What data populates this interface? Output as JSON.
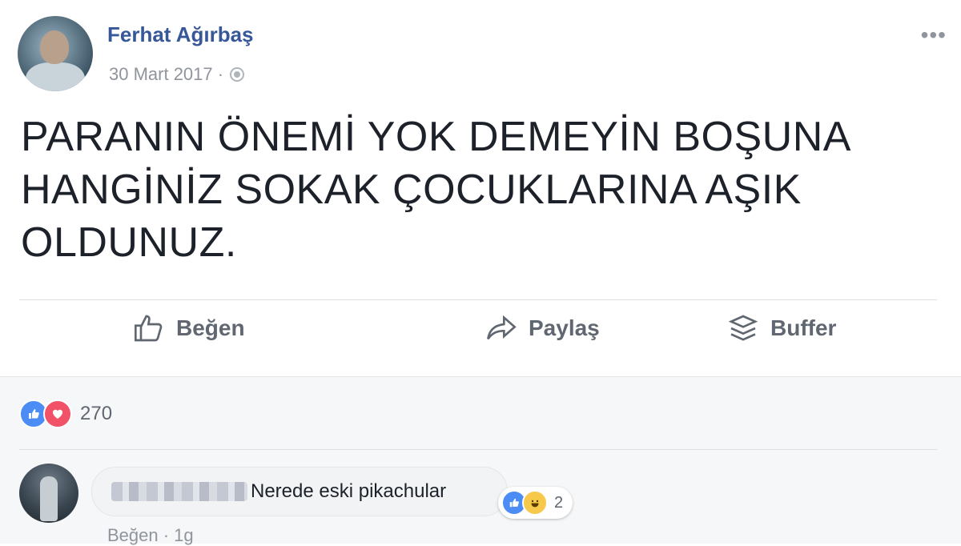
{
  "post": {
    "author": "Ferhat Ağırbaş",
    "date": "30 Mart 2017 ·",
    "privacy_icon": "globe-icon",
    "more_label": "•••",
    "text_lines": [
      "PARANIN ÖNEMİ YOK DEMEYİN BOŞUNA",
      "HANGİNİZ SOKAK ÇOCUKLARINA AŞIK",
      "OLDUNUZ."
    ]
  },
  "actions": {
    "like": "Beğen",
    "share": "Paylaş",
    "buffer": "Buffer"
  },
  "reactions": {
    "count": "270",
    "types": [
      "like",
      "love"
    ]
  },
  "comment": {
    "text": "Nerede eski pikachular",
    "reaction_count": "2",
    "reaction_types": [
      "like",
      "haha"
    ],
    "footer": "Beğen · 1g"
  },
  "colors": {
    "author": "#365899",
    "like": "#4b8cf5",
    "love": "#f25268",
    "haha": "#f7c94a",
    "muted": "#90949c"
  }
}
